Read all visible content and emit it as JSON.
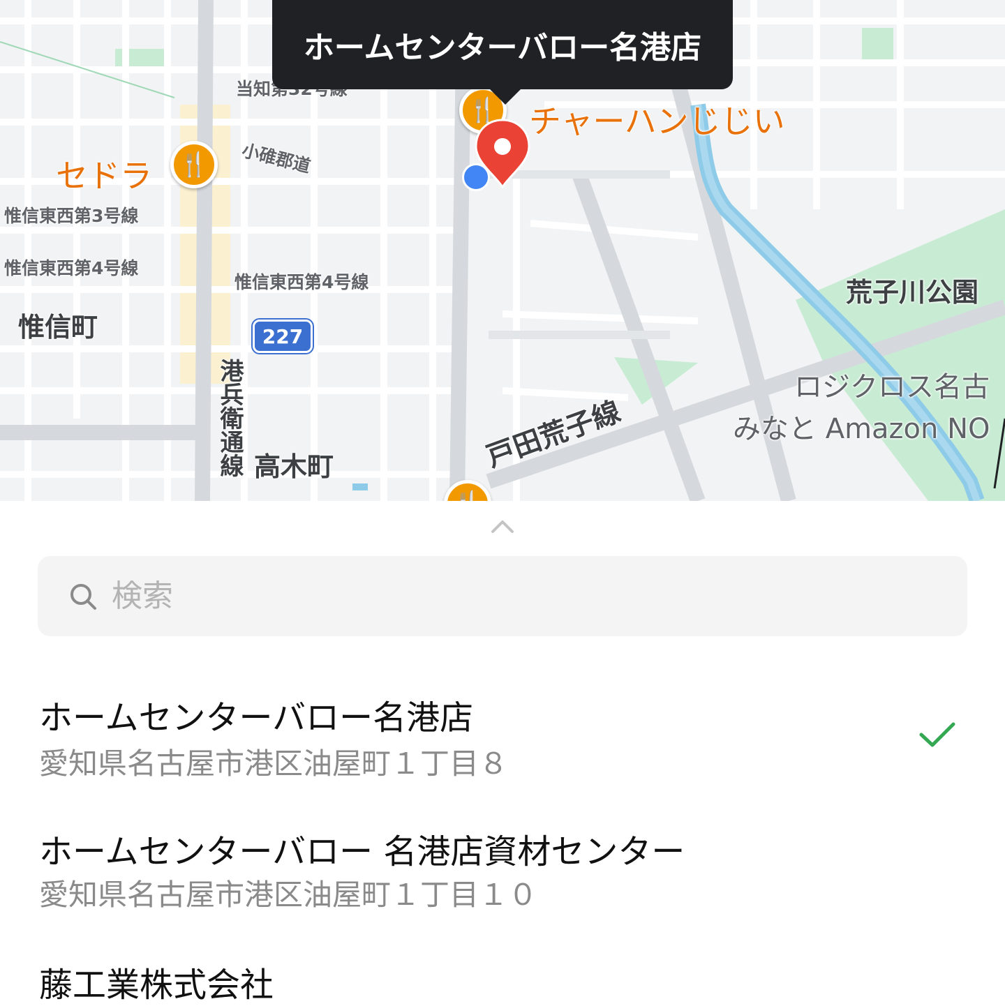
{
  "map": {
    "callout_title": "ホームセンターバロー名港店",
    "poi_labels": {
      "chahan": "チャーハンじじい",
      "sedora": "セドラ"
    },
    "road_labels": {
      "atochi": "当知第32号線",
      "komiso": "小碓郡道",
      "ishin3": "惟信東西第3号線",
      "ishin4_left": "惟信東西第4号線",
      "ishin4_center": "惟信東西第4号線",
      "heieei": "港兵衛通線",
      "todaarako": "戸田荒子線"
    },
    "area_labels": {
      "ishincho": "惟信町",
      "takagicho": "高木町",
      "arakogawa_park": "荒子川公園",
      "logicross": "ロジクロス名古",
      "amazon": "みなと Amazon NO"
    },
    "route_number": "227",
    "icons": [
      "restaurant-icon",
      "location-pin-icon",
      "current-location-dot"
    ],
    "colors": {
      "poi": "#f29900",
      "pin": "#ea4335",
      "dot": "#4285f4",
      "park": "#c8ecd3",
      "river": "#8ecbe8"
    }
  },
  "sheet": {
    "search_placeholder": "検索",
    "results": [
      {
        "name": "ホームセンターバロー名港店",
        "address": "愛知県名古屋市港区油屋町１丁目８",
        "selected": true
      },
      {
        "name": "ホームセンターバロー 名港店資材センター",
        "address": "愛知県名古屋市港区油屋町１丁目１０",
        "selected": false
      },
      {
        "name": "藤工業株式会社",
        "address": "",
        "selected": false
      }
    ],
    "check_color": "#34a853"
  }
}
